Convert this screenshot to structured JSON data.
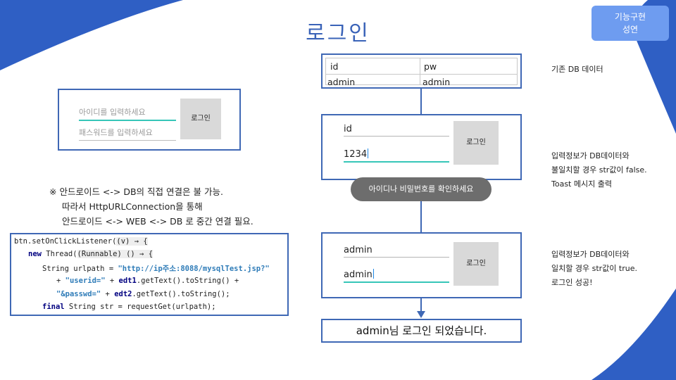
{
  "title": "로그인",
  "badge": {
    "line1": "기능구현",
    "line2": "성연"
  },
  "left_form": {
    "id_placeholder": "아이디를 입력하세요",
    "pw_placeholder": "패스워드를 입력하세요",
    "login_button": "로그인"
  },
  "note": {
    "line1": "※ 안드로이드 <-> DB의 직접 연결은 불 가능.",
    "line2": "따라서 HttpURLConnection을 통해",
    "line3": "안드로이드 <-> WEB <-> DB 로 중간 연결 필요."
  },
  "code": {
    "l1_a": "btn.setOnClickListener(",
    "l1_b": "(v) → {",
    "l2_kw": "new",
    "l2_a": " Thread(",
    "l2_b": "(Runnable) () → {",
    "l3_a": "String urlpath = ",
    "l3_str": "\"http://ip주소:8088/mysqlTest.jsp?\"",
    "l4_a": "+ ",
    "l4_str": "\"userid=\"",
    "l4_b": " + ",
    "l4_kw": "edt1",
    "l4_c": ".getText().toString() +",
    "l5_str": "\"&passwd=\"",
    "l5_a": " + ",
    "l5_kw": "edt2",
    "l5_b": ".getText().toString();",
    "l6_kw": "final",
    "l6_a": " String str = requestGet(urlpath);"
  },
  "db_table": {
    "headers": [
      "id",
      "pw"
    ],
    "row": [
      "admin",
      "admin"
    ]
  },
  "fail_form": {
    "id_value": "id",
    "pw_value": "1234",
    "login_button": "로그인",
    "toast": "아이디나 비밀번호를 확인하세요"
  },
  "success_form": {
    "id_value": "admin",
    "pw_value": "admin",
    "login_button": "로그인"
  },
  "result_text": "admin님 로그인 되었습니다.",
  "descriptions": {
    "d1": "기존 DB 데이터",
    "d2_l1": "입력정보가 DB데이터와",
    "d2_l2": "불일치할 경우 str값이 false.",
    "d2_l3": "Toast 메시지 출력",
    "d3_l1": "입력정보가 DB데이터와",
    "d3_l2": "일치할 경우 str값이 true.",
    "d3_l3": "로그인 성공!"
  },
  "colors": {
    "accent": "#3f68b5",
    "deco_blue": "#2f5fc4",
    "badge": "#6e9cf0",
    "focus": "#36c6b8"
  }
}
